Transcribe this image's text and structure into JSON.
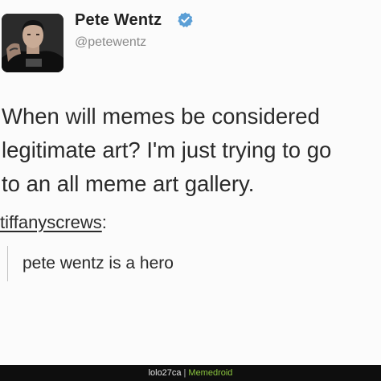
{
  "author": {
    "display_name": "Pete Wentz",
    "handle": "@petewentz",
    "avatar_icon": "profile-photo",
    "verified_icon": "verified-badge-icon",
    "verified_color": "#1da1f2"
  },
  "tweet": {
    "lines": [
      "When will memes be considered",
      "legitimate art? I'm just trying to go",
      "to an all meme art gallery."
    ]
  },
  "reply": {
    "username": "tiffanyscrews",
    "suffix": ":",
    "text": "pete wentz is a hero"
  },
  "footer": {
    "uploader": "lolo27ca",
    "separator": "|",
    "brand": "Memedroid",
    "brand_color": "#8cc63f"
  }
}
